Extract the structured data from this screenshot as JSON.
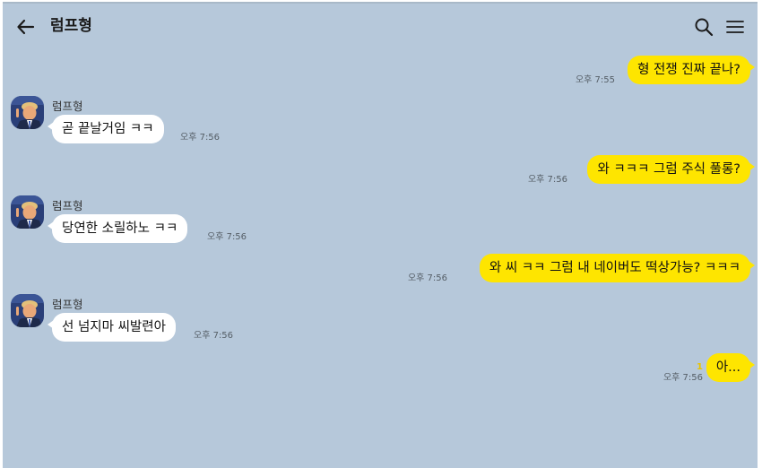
{
  "header": {
    "title": "럼프형"
  },
  "colors": {
    "background": "#b6c8da",
    "outgoing_bubble": "#fee500",
    "incoming_bubble": "#ffffff"
  },
  "messages": [
    {
      "direction": "out",
      "text": "형 전쟁 진짜 끝나?",
      "time": "오후 7:55"
    },
    {
      "direction": "in",
      "sender": "럼프형",
      "text": "곧 끝날거임 ㅋㅋ",
      "time": "오후 7:56"
    },
    {
      "direction": "out",
      "text": "와 ㅋㅋㅋ 그럼 주식 풀롱?",
      "time": "오후 7:56"
    },
    {
      "direction": "in",
      "sender": "럼프형",
      "text": "당연한 소릴하노 ㅋㅋ",
      "time": "오후 7:56"
    },
    {
      "direction": "out",
      "text": "와 씨 ㅋㅋ 그럼 내 네이버도 떡상가능? ㅋㅋㅋ",
      "time": "오후 7:56"
    },
    {
      "direction": "in",
      "sender": "럼프형",
      "text": "선 넘지마 씨발련아",
      "time": "오후 7:56"
    },
    {
      "direction": "out",
      "text": "아...",
      "time": "오후 7:56",
      "unread": "1"
    }
  ]
}
